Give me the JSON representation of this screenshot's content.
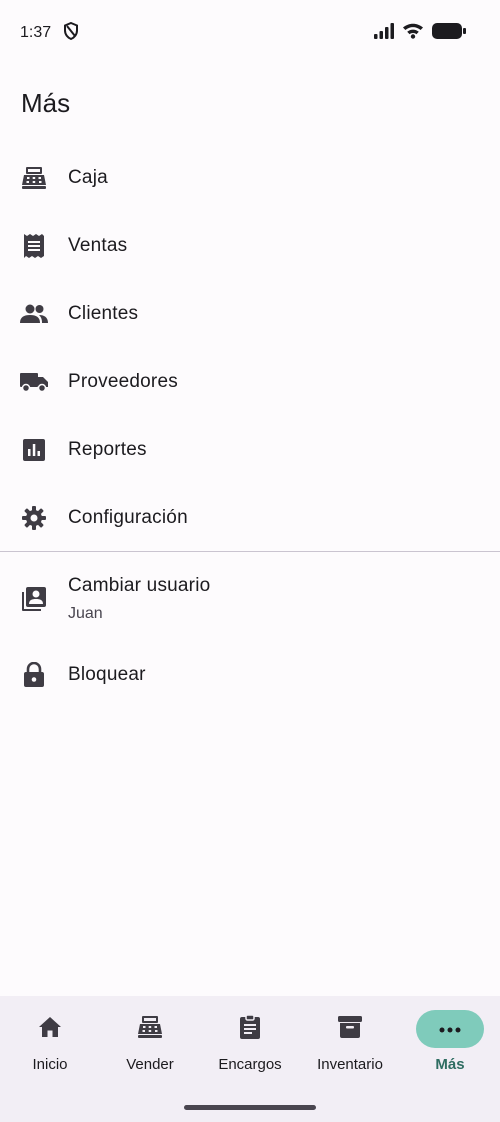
{
  "status_bar": {
    "time": "1:37",
    "icons": [
      "shield-icon",
      "signal-icon",
      "wifi-icon",
      "battery-icon"
    ]
  },
  "page": {
    "title": "Más"
  },
  "menu": [
    {
      "label": "Caja",
      "icon": "cash-register-icon"
    },
    {
      "label": "Ventas",
      "icon": "receipt-icon"
    },
    {
      "label": "Clientes",
      "icon": "people-icon"
    },
    {
      "label": "Proveedores",
      "icon": "truck-icon"
    },
    {
      "label": "Reportes",
      "icon": "bar-chart-icon"
    },
    {
      "label": "Configuración",
      "icon": "gear-icon"
    }
  ],
  "user_switch": {
    "label": "Cambiar usuario",
    "current_user": "Juan",
    "icon": "switch-account-icon"
  },
  "lock": {
    "label": "Bloquear",
    "icon": "lock-icon"
  },
  "bottom_nav": [
    {
      "label": "Inicio",
      "icon": "home-icon",
      "active": false
    },
    {
      "label": "Vender",
      "icon": "cash-register-icon",
      "active": false
    },
    {
      "label": "Encargos",
      "icon": "clipboard-icon",
      "active": false
    },
    {
      "label": "Inventario",
      "icon": "archive-icon",
      "active": false
    },
    {
      "label": "Más",
      "icon": "more-dots-icon",
      "active": true
    }
  ],
  "colors": {
    "accent": "#7fcbbb",
    "accent_text": "#2f6d62",
    "icon": "#3f3c44",
    "nav_background": "#f2eef5"
  }
}
